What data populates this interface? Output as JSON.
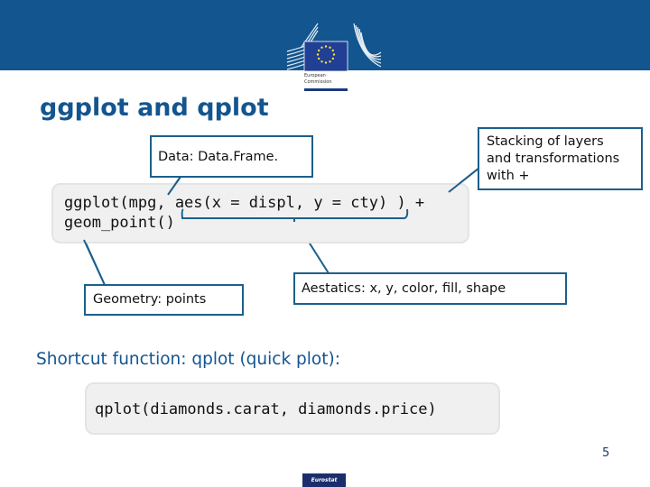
{
  "header": {
    "organization_line1": "European",
    "organization_line2": "Commission",
    "logo_icon": "eu-flag-icon"
  },
  "slide": {
    "title": "ggplot and qplot",
    "callouts": {
      "data": "Data: Data.Frame.",
      "stacking": [
        "Stacking of layers",
        "and transformations",
        "with +"
      ],
      "geometry": "Geometry: points",
      "aesthetics": "Aestatics: x, y, color, fill, shape"
    },
    "code_ggplot": [
      "ggplot(mpg, aes(x = displ, y = cty) ) +",
      "geom_point()"
    ],
    "subtitle": "Shortcut function: qplot (quick plot):",
    "code_qplot": "qplot(diamonds.carat, diamonds.price)"
  },
  "footer": {
    "page_number": "5",
    "badge": "Eurostat"
  },
  "colors": {
    "banner": "#13558f",
    "title": "#13558f",
    "callout_border": "#1c5f8c",
    "code_bg": "#f0f0f0",
    "eurostat_badge": "#1b2e6b"
  }
}
